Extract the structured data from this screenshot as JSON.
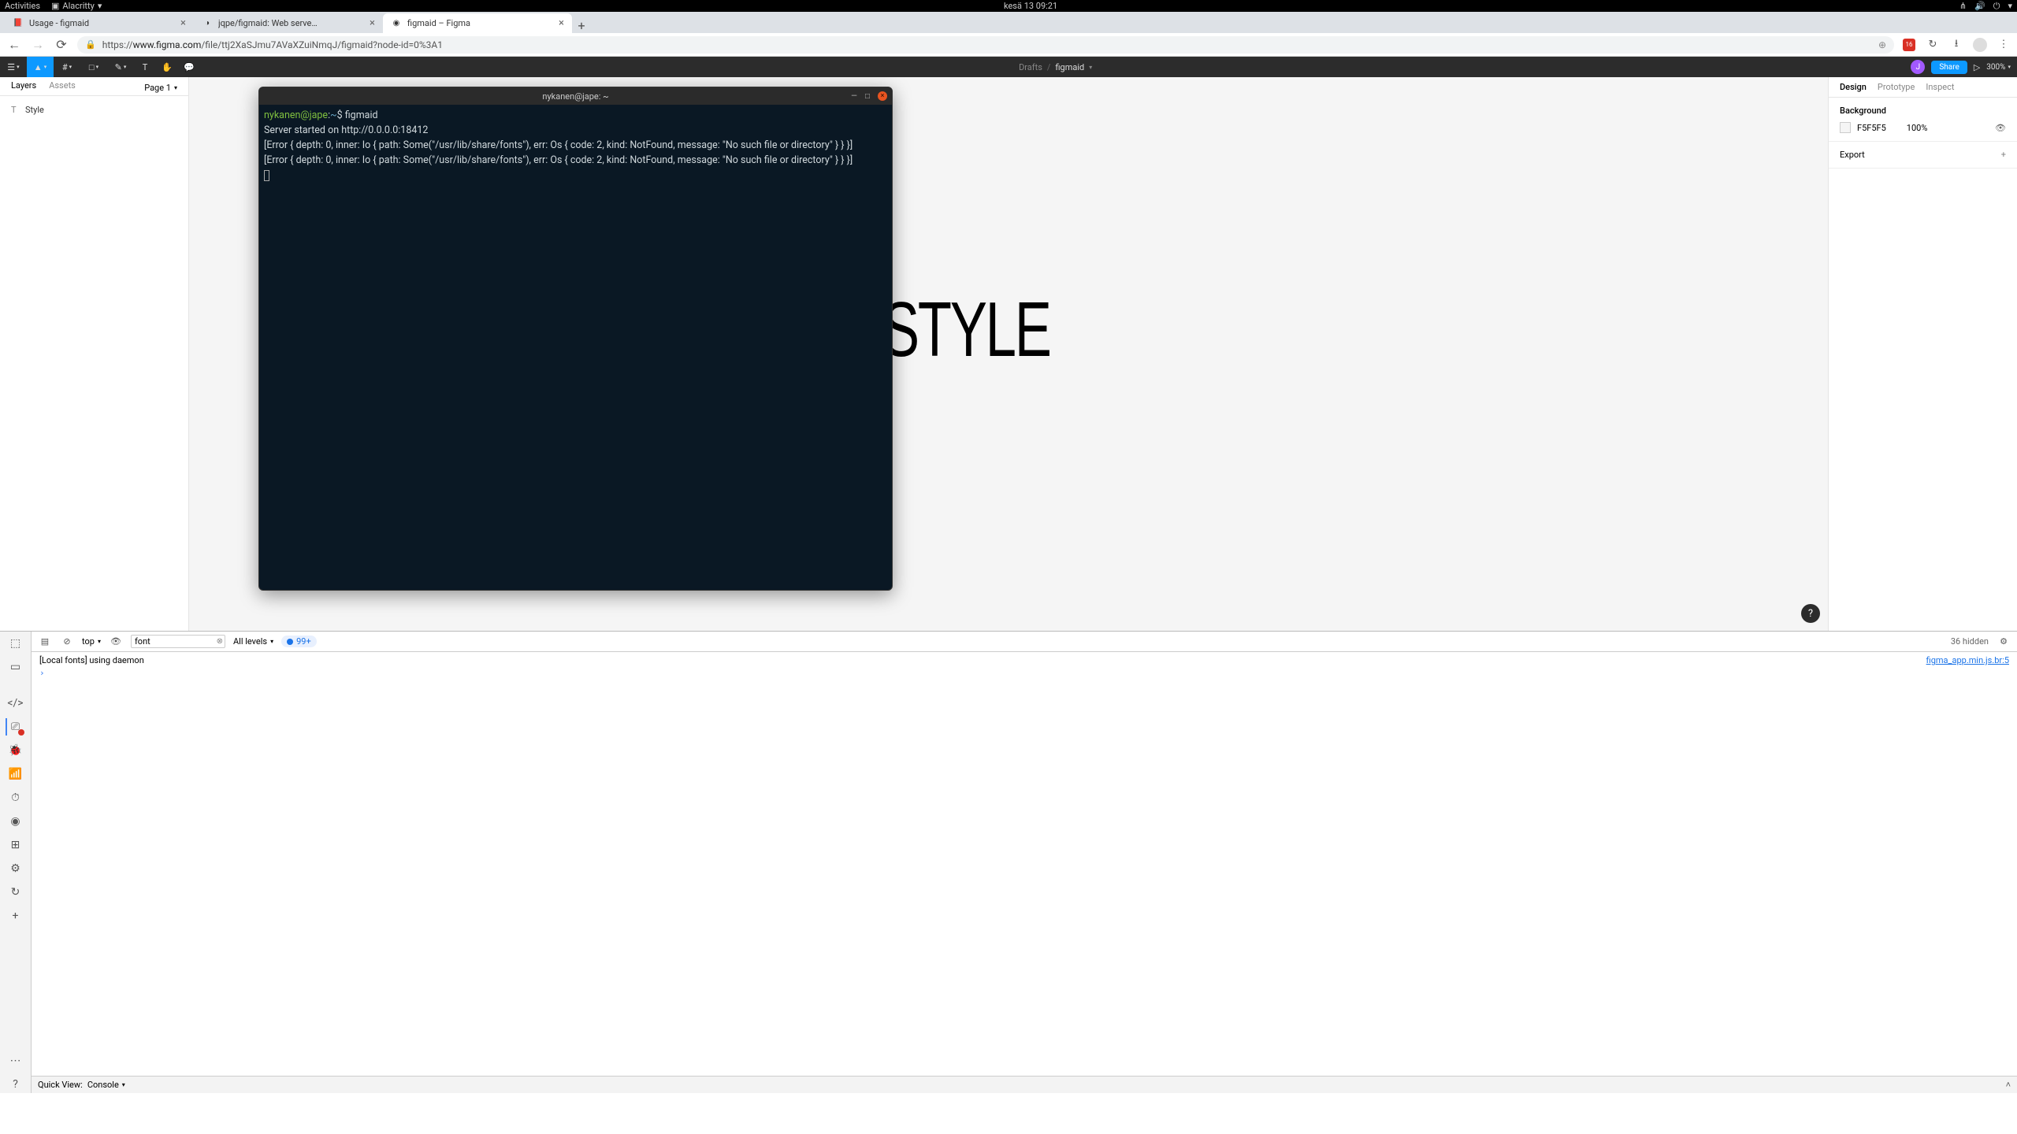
{
  "gnome": {
    "activities": "Activities",
    "app": "Alacritty",
    "clock": "kesä 13  09:21"
  },
  "browser": {
    "tabs": [
      {
        "title": "Usage - figmaid"
      },
      {
        "title": "jqpe/figmaid: Web serve…"
      },
      {
        "title": "figmaid – Figma"
      }
    ],
    "url_prefix": "https://",
    "url_domain": "www.figma.com",
    "url_path": "/file/ttj2XaSJmu7AVaXZuiNmqJ/figmaid?node-id=0%3A1",
    "ext_badge": "16"
  },
  "figma": {
    "breadcrumb_root": "Drafts",
    "breadcrumb_file": "figmaid",
    "avatar_initial": "J",
    "share": "Share",
    "zoom": "300%",
    "layers_tab": "Layers",
    "assets_tab": "Assets",
    "page_label": "Page 1",
    "layer_items": [
      "Style"
    ],
    "canvas_text": "STYLE",
    "design_tab": "Design",
    "prototype_tab": "Prototype",
    "inspect_tab": "Inspect",
    "background_title": "Background",
    "bg_hex": "F5F5F5",
    "bg_pct": "100%",
    "export_title": "Export"
  },
  "terminal": {
    "title": "nykanen@jape: ~",
    "prompt_user": "nykanen@jape",
    "prompt_sep": ":",
    "prompt_path": "~",
    "prompt_dollar": "$ ",
    "command": "figmaid",
    "lines": [
      "Server started on http://0.0.0.0:18412",
      "[Error { depth: 0, inner: Io { path: Some(\"/usr/lib/share/fonts\"), err: Os { code: 2, kind: NotFound, message: \"No such file or directory\" } } }]",
      "[Error { depth: 0, inner: Io { path: Some(\"/usr/lib/share/fonts\"), err: Os { code: 2, kind: NotFound, message: \"No such file or directory\" } } }]"
    ]
  },
  "devtools": {
    "context": "top",
    "filter_value": "font",
    "levels_label": "All levels",
    "issues_count": "99+",
    "hidden_label": "36 hidden",
    "log_msg": "[Local fonts] using daemon",
    "log_src": "figma_app.min.js.br:5",
    "quick_view_label": "Quick View:",
    "quick_view_value": "Console"
  }
}
